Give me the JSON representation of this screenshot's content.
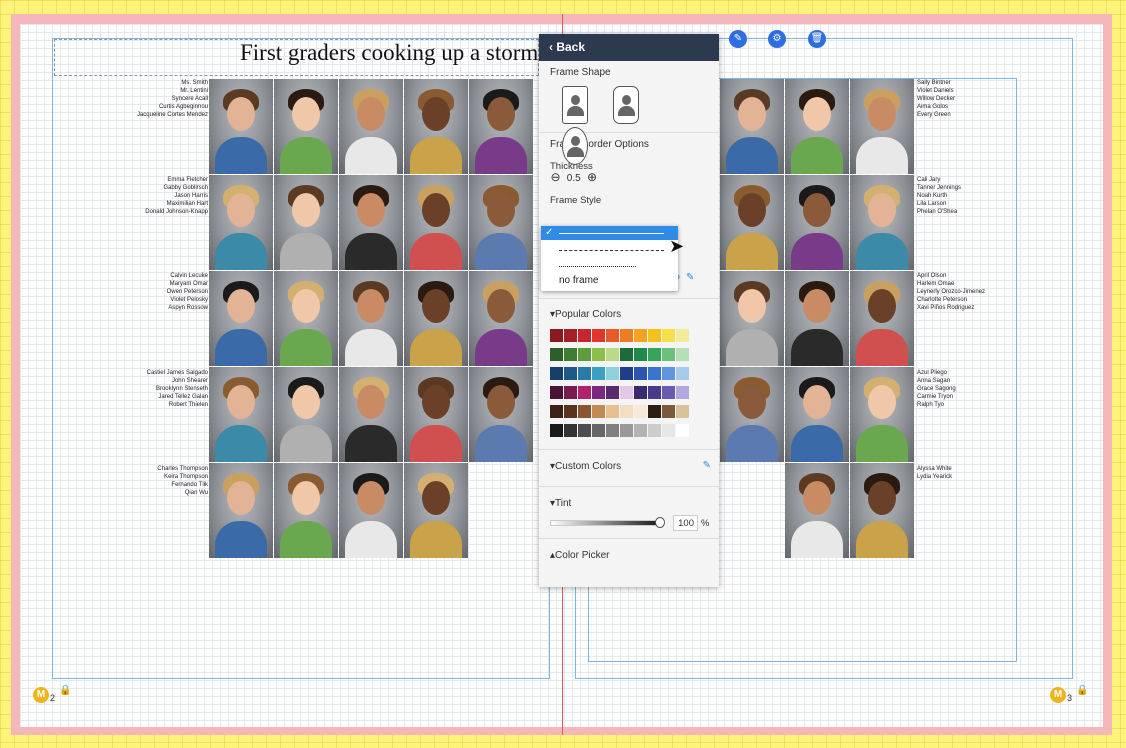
{
  "spread": {
    "title": "First graders cooking up a storm",
    "left_page_number": "2",
    "right_page_number": "3",
    "badge_letter": "M"
  },
  "names_left": [
    [
      "Ms. Smith",
      "Mr. Lentini",
      "Syncere Acall",
      "Curtis Agbeginnou",
      "Jacqueline Cortes Mendez"
    ],
    [
      "Emma Fletcher",
      "Gabby Goblirsch",
      "Jason Harris",
      "Maximilian Hart",
      "Donald Johnson-Knapp"
    ],
    [
      "Calvin Lecuke",
      "Maryam Omar",
      "Owen Peterson",
      "Violet Pelosky",
      "Aspyn Rossow"
    ],
    [
      "Castiel James Salgado",
      "John Shearer",
      "Brooklynn Stenseth",
      "Jared Tellez Galan",
      "Robert Thielen"
    ],
    [
      "Charles Thompson",
      "Keira Thompson",
      "Fernando Tlik",
      "Qian Wu"
    ]
  ],
  "names_right": [
    [
      "Sally Bintner",
      "Violet Daniels",
      "Willow Decker",
      "Aima Golos",
      "Every Green"
    ],
    [
      "Cali Jary",
      "Tanner Jennings",
      "Noah Kurth",
      "Lila Larson",
      "Phelan O'Shea"
    ],
    [
      "April Olson",
      "Harlem Omae",
      "Leynerly Orozco-Jimenez",
      "Charlotte Peterson",
      "Xavi Piños Rodriguez"
    ],
    [
      "Azul Pliego",
      "Anna Sagan",
      "Grace Sagong",
      "Carmie Tryon",
      "Ralph Tyo"
    ],
    [
      "Alyssa White",
      "Lydia Yearick"
    ]
  ],
  "panel": {
    "back_label": "Back",
    "frame_shape_label": "Frame Shape",
    "frame_border_label": "Frame Border Options",
    "thickness_label": "Thickness",
    "thickness_value": "0.5",
    "minus_icon": "⊖",
    "plus_icon": "⊕",
    "frame_style_label": "Frame Style",
    "color_hex": "#1C1C1A",
    "popular_colors_label": "Popular Colors",
    "custom_colors_label": "Custom Colors",
    "tint_label": "Tint",
    "tint_value": "100",
    "tint_unit": "%",
    "color_picker_label": "Color Picker"
  },
  "dropdown": {
    "checkmark": "✓",
    "no_frame_label": "no frame",
    "selected_style": "solid"
  },
  "popular_colors": [
    [
      "#8b1a1f",
      "#a3222a",
      "#c8262d",
      "#e0362b",
      "#e85b28",
      "#ef7b22",
      "#f2a31f",
      "#f5c21c",
      "#f5e04a",
      "#f3ec9c"
    ],
    [
      "#2e5e2a",
      "#3f7d33",
      "#5d9e3c",
      "#8cbf4a",
      "#bcd987",
      "#1f6a3a",
      "#1f8a4a",
      "#35a55a",
      "#6cc07a",
      "#b5dfb7"
    ],
    [
      "#163f6b",
      "#1d5a8a",
      "#2a7ca8",
      "#3aa0c3",
      "#8fd0dc",
      "#1e3d8a",
      "#2b56b0",
      "#3b74cf",
      "#5e97e0",
      "#a8c9ee"
    ],
    [
      "#4a1233",
      "#7a1a4f",
      "#b0226e",
      "#7a2a7e",
      "#5a2a6e",
      "#e3c7e6",
      "#3b2a6e",
      "#4a3a8e",
      "#6a5ab0",
      "#b3a8dc"
    ],
    [
      "#3a2217",
      "#5a3420",
      "#8a5530",
      "#c28a55",
      "#e8c090",
      "#f3dfc0",
      "#f6ead8",
      "#2a1f14",
      "#7a5a3a",
      "#d7c09a"
    ],
    [
      "#1a1a1a",
      "#333333",
      "#4d4d4d",
      "#666666",
      "#808080",
      "#999999",
      "#b3b3b3",
      "#cccccc",
      "#e6e6e6",
      "#ffffff"
    ]
  ],
  "accent": "#2f8be8",
  "header_bg": "#2b3a4f"
}
